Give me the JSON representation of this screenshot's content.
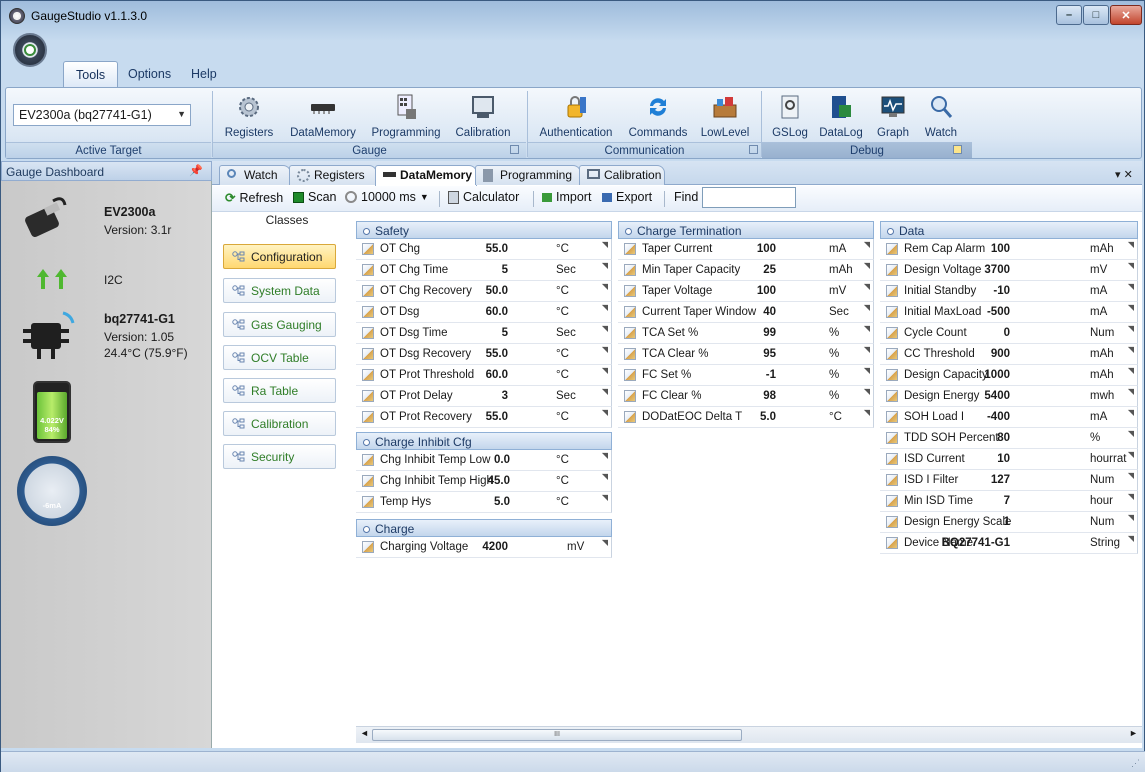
{
  "window": {
    "title": "GaugeStudio v1.1.3.0",
    "min_label": "–",
    "max_label": "□",
    "close_label": "✕"
  },
  "ribbon": {
    "tabs": [
      "Tools",
      "Options",
      "Help"
    ],
    "target_combo": "EV2300a (bq27741-G1)",
    "groups": {
      "active_target": "Active Target",
      "gauge": "Gauge",
      "communication": "Communication",
      "debug": "Debug"
    },
    "buttons": {
      "registers": "Registers",
      "datamemory": "DataMemory",
      "programming": "Programming",
      "calibration": "Calibration",
      "authentication": "Authentication",
      "commands": "Commands",
      "lowlevel": "LowLevel",
      "gslog": "GSLog",
      "datalog": "DataLog",
      "graph": "Graph",
      "watch": "Watch"
    }
  },
  "dashboard": {
    "title": "Gauge Dashboard",
    "adapter_name": "EV2300a",
    "adapter_version": "Version: 3.1r",
    "bus": "I2C",
    "device_name": "bq27741-G1",
    "device_version": "Version: 1.05",
    "temperature": "24.4°C (75.9°F)",
    "battery_voltage": "4.022V",
    "battery_percent": "84%",
    "battery_level": 0.84,
    "current": "-6mA"
  },
  "tabs": [
    "Watch",
    "Registers",
    "DataMemory",
    "Programming",
    "Calibration"
  ],
  "toolbar": {
    "refresh": "Refresh",
    "scan": "Scan",
    "interval": "10000 ms",
    "calculator": "Calculator",
    "import": "Import",
    "export": "Export",
    "find": "Find",
    "find_value": ""
  },
  "classes": {
    "header": "Classes",
    "items": [
      "Configuration",
      "System Data",
      "Gas Gauging",
      "OCV Table",
      "Ra Table",
      "Calibration",
      "Security"
    ]
  },
  "panels": [
    {
      "title": "Safety",
      "rows": [
        {
          "name": "OT Chg",
          "value": "55.0",
          "unit": "°C"
        },
        {
          "name": "OT Chg Time",
          "value": "5",
          "unit": "Sec"
        },
        {
          "name": "OT Chg Recovery",
          "value": "50.0",
          "unit": "°C"
        },
        {
          "name": "OT Dsg",
          "value": "60.0",
          "unit": "°C"
        },
        {
          "name": "OT Dsg Time",
          "value": "5",
          "unit": "Sec"
        },
        {
          "name": "OT Dsg Recovery",
          "value": "55.0",
          "unit": "°C"
        },
        {
          "name": "OT Prot Threshold",
          "value": "60.0",
          "unit": "°C"
        },
        {
          "name": "OT Prot Delay",
          "value": "3",
          "unit": "Sec"
        },
        {
          "name": "OT Prot Recovery",
          "value": "55.0",
          "unit": "°C"
        }
      ]
    },
    {
      "title": "Charge Inhibit Cfg",
      "rows": [
        {
          "name": "Chg Inhibit Temp Low",
          "value": "0.0",
          "unit": "°C"
        },
        {
          "name": "Chg Inhibit Temp High",
          "value": "45.0",
          "unit": "°C"
        },
        {
          "name": "Temp Hys",
          "value": "5.0",
          "unit": "°C"
        }
      ]
    },
    {
      "title": "Charge",
      "rows": [
        {
          "name": "Charging Voltage",
          "value": "4200",
          "unit": "mV"
        }
      ]
    },
    {
      "title": "Charge Termination",
      "rows": [
        {
          "name": "Taper Current",
          "value": "100",
          "unit": "mA"
        },
        {
          "name": "Min Taper Capacity",
          "value": "25",
          "unit": "mAh"
        },
        {
          "name": "Taper Voltage",
          "value": "100",
          "unit": "mV"
        },
        {
          "name": "Current Taper Window",
          "value": "40",
          "unit": "Sec"
        },
        {
          "name": "TCA Set %",
          "value": "99",
          "unit": "%"
        },
        {
          "name": "TCA Clear %",
          "value": "95",
          "unit": "%"
        },
        {
          "name": "FC Set %",
          "value": "-1",
          "unit": "%"
        },
        {
          "name": "FC Clear %",
          "value": "98",
          "unit": "%"
        },
        {
          "name": "DODatEOC Delta T",
          "value": "5.0",
          "unit": "°C"
        }
      ]
    },
    {
      "title": "Data",
      "rows": [
        {
          "name": "Rem Cap Alarm",
          "value": "100",
          "unit": "mAh"
        },
        {
          "name": "Design Voltage",
          "value": "3700",
          "unit": "mV"
        },
        {
          "name": "Initial Standby",
          "value": "-10",
          "unit": "mA"
        },
        {
          "name": "Initial MaxLoad",
          "value": "-500",
          "unit": "mA"
        },
        {
          "name": "Cycle Count",
          "value": "0",
          "unit": "Num"
        },
        {
          "name": "CC Threshold",
          "value": "900",
          "unit": "mAh"
        },
        {
          "name": "Design Capacity",
          "value": "1000",
          "unit": "mAh"
        },
        {
          "name": "Design Energy",
          "value": "5400",
          "unit": "mwh"
        },
        {
          "name": "SOH Load I",
          "value": "-400",
          "unit": "mA"
        },
        {
          "name": "TDD SOH Percent",
          "value": "80",
          "unit": "%"
        },
        {
          "name": "ISD Current",
          "value": "10",
          "unit": "hourrat"
        },
        {
          "name": "ISD I Filter",
          "value": "127",
          "unit": "Num"
        },
        {
          "name": "Min ISD Time",
          "value": "7",
          "unit": "hour"
        },
        {
          "name": "Design Energy Scale",
          "value": "1",
          "unit": "Num"
        },
        {
          "name": "Device Name",
          "value": "BQ27741-G1",
          "unit": "String"
        }
      ]
    }
  ],
  "scrollbar": {
    "thumb_grip": "III"
  }
}
